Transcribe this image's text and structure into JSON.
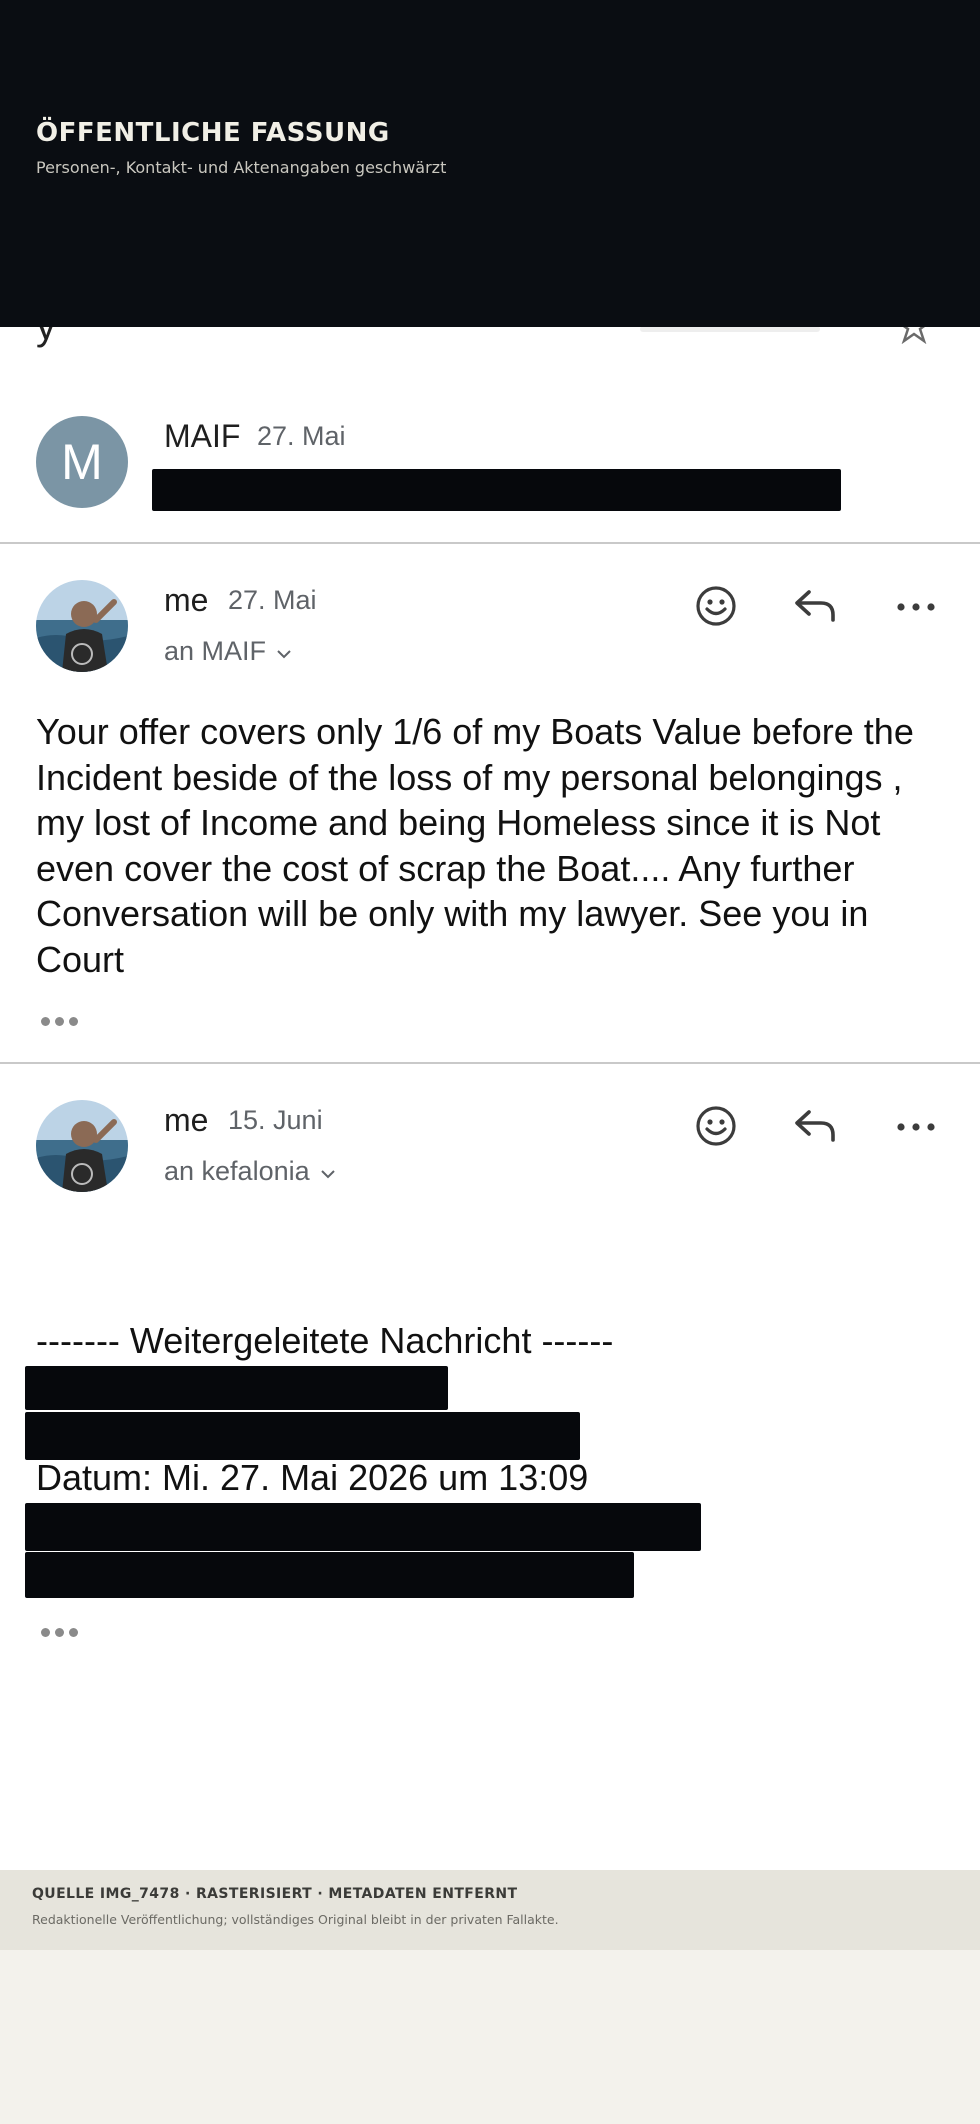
{
  "banner": {
    "title": "ÖFFENTLICHE FASSUNG",
    "subtitle": "Personen-, Kontakt- und Aktenangaben geschwärzt"
  },
  "messages": [
    {
      "avatar_letter": "M",
      "sender": "MAIF",
      "date": "27. Mai"
    },
    {
      "sender": "me",
      "date": "27. Mai",
      "recipient": "an MAIF",
      "body": "Your offer covers only 1/6 of my Boats Value before the Incident beside of the loss of my personal belongings , my lost of Income and being Homeless since  it is Not even  cover the cost of scrap the Boat.... Any further Conversation will be only with my lawyer. See you in Court"
    },
    {
      "sender": "me",
      "date": "15. Juni",
      "recipient": "an kefalonia",
      "forward_header": "------- Weitergeleitete Nachricht ------",
      "forward_date": "Datum: Mi. 27. Mai 2026 um 13:09"
    }
  ],
  "icons": {
    "react": "smiley-icon",
    "reply": "reply-icon",
    "more": "more-horiz-icon",
    "expand": "chevron-down-icon",
    "star": "star-icon"
  },
  "footer": {
    "main": "QUELLE IMG_7478 · RASTERISIERT · METADATEN ENTFERNT",
    "sub": "Redaktionelle Veröffentlichung; vollständiges Original bleibt in der privaten Fallakte."
  },
  "colors": {
    "banner_bg": "#0a0d12",
    "avatar_bg": "#7b95a5",
    "redaction": "#06080c",
    "footer_bg": "#e6e4dc",
    "page_bg": "#f3f2ec"
  }
}
